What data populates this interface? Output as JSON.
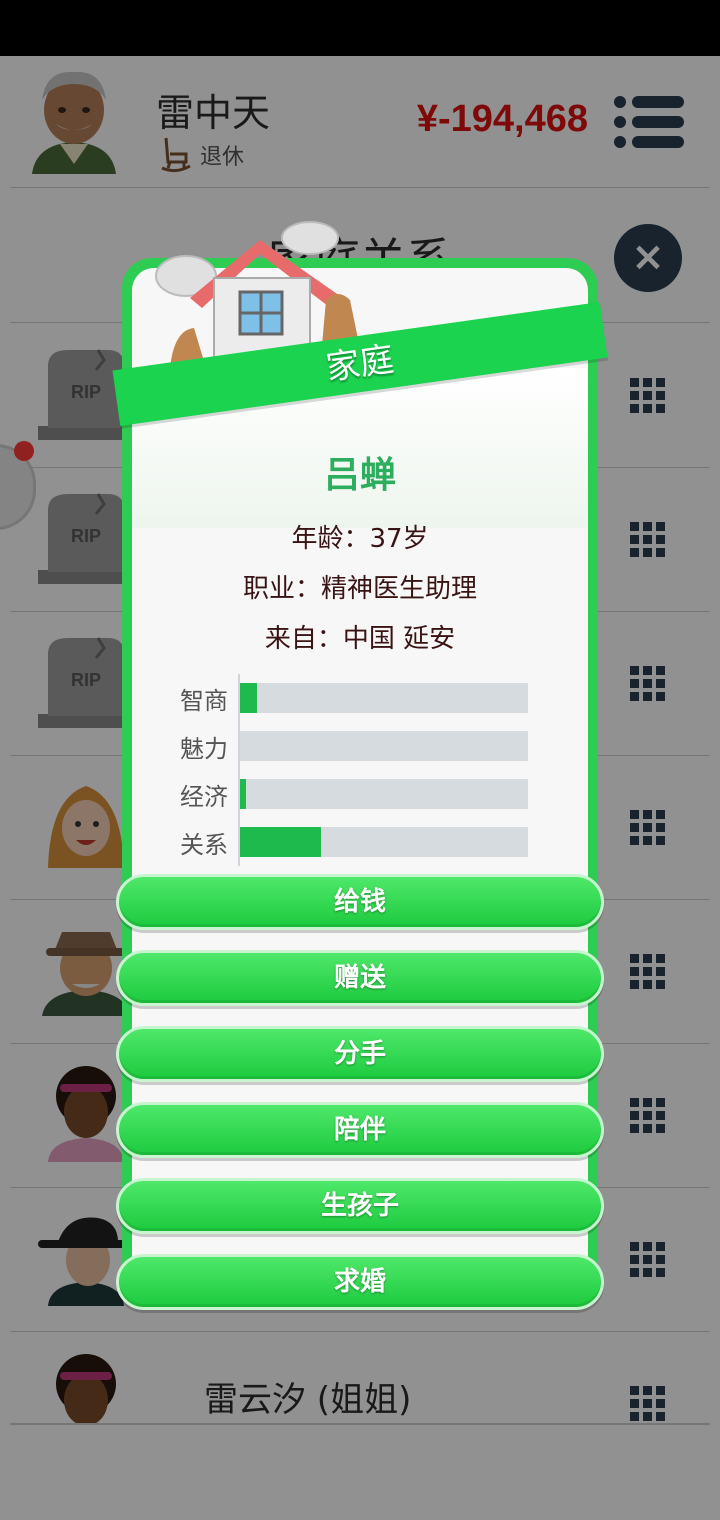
{
  "header": {
    "player_name": "雷中天",
    "status": "退休",
    "money": "¥-194,468"
  },
  "page": {
    "title": "家庭关系"
  },
  "relations": [
    {
      "name": "",
      "avatar": "tombstone",
      "tomb_text": "RIP"
    },
    {
      "name": "",
      "avatar": "tombstone",
      "tomb_text": "RIP"
    },
    {
      "name": "",
      "avatar": "tombstone",
      "tomb_text": "RIP"
    },
    {
      "name": "",
      "avatar": "woman-blonde"
    },
    {
      "name": "",
      "avatar": "old-man-hat"
    },
    {
      "name": "",
      "avatar": "woman-dark-headband"
    },
    {
      "name": "",
      "avatar": "old-woman-hat"
    },
    {
      "name": "雷云汐 (姐姐)",
      "avatar": "woman-dark-headband"
    }
  ],
  "modal": {
    "category": "家庭",
    "person_name": "吕蝉",
    "age": "年龄：37岁",
    "job": "职业：精神医生助理",
    "origin": "来自：中国 延安",
    "stats": [
      {
        "label": "智商",
        "value": 0.06
      },
      {
        "label": "魅力",
        "value": 0.0
      },
      {
        "label": "经济",
        "value": 0.02
      },
      {
        "label": "关系",
        "value": 0.28
      }
    ],
    "actions": [
      "给钱",
      "赠送",
      "分手",
      "陪伴",
      "生孩子",
      "求婚"
    ]
  },
  "colors": {
    "accent": "#1bd34f",
    "money": "#dd1111",
    "name": "#2cae5e"
  }
}
